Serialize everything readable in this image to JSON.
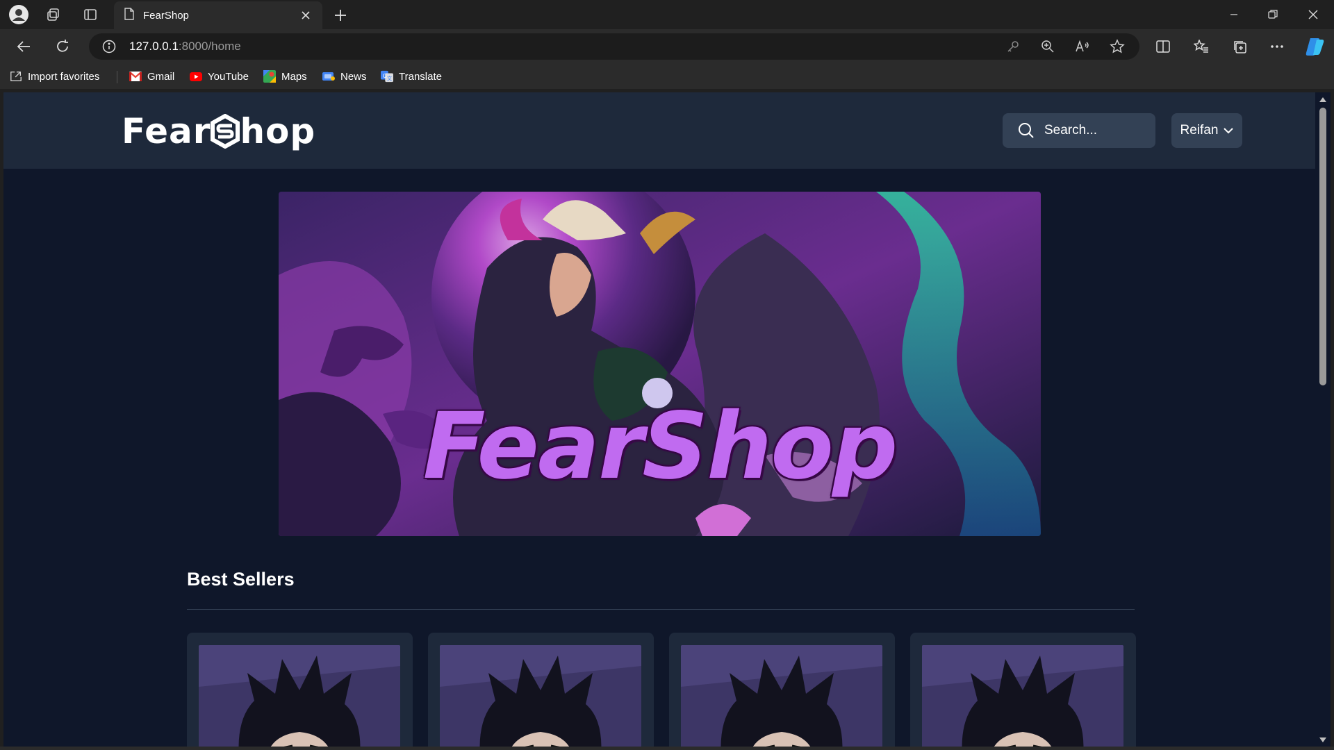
{
  "browser": {
    "tab": {
      "title": "FearShop"
    },
    "address": {
      "host": "127.0.0.1",
      "path": ":8000/home"
    },
    "favorites": [
      {
        "label": "Import favorites",
        "icon": "import-icon"
      },
      {
        "label": "Gmail",
        "icon": "gmail-icon"
      },
      {
        "label": "YouTube",
        "icon": "youtube-icon"
      },
      {
        "label": "Maps",
        "icon": "maps-icon"
      },
      {
        "label": "News",
        "icon": "news-icon"
      },
      {
        "label": "Translate",
        "icon": "translate-icon"
      }
    ]
  },
  "site": {
    "logo": {
      "part1": "Fear",
      "part2": "hop"
    },
    "search": {
      "placeholder": "Search..."
    },
    "user": {
      "name": "Reifan"
    },
    "banner": {
      "title": "FearShop"
    },
    "best_sellers": {
      "heading": "Best Sellers",
      "card_count": 4
    }
  },
  "colors": {
    "page_bg": "#0f172a",
    "header_bg": "#1e293b",
    "control_bg": "#334155",
    "banner_accent": "#c06bf0"
  }
}
